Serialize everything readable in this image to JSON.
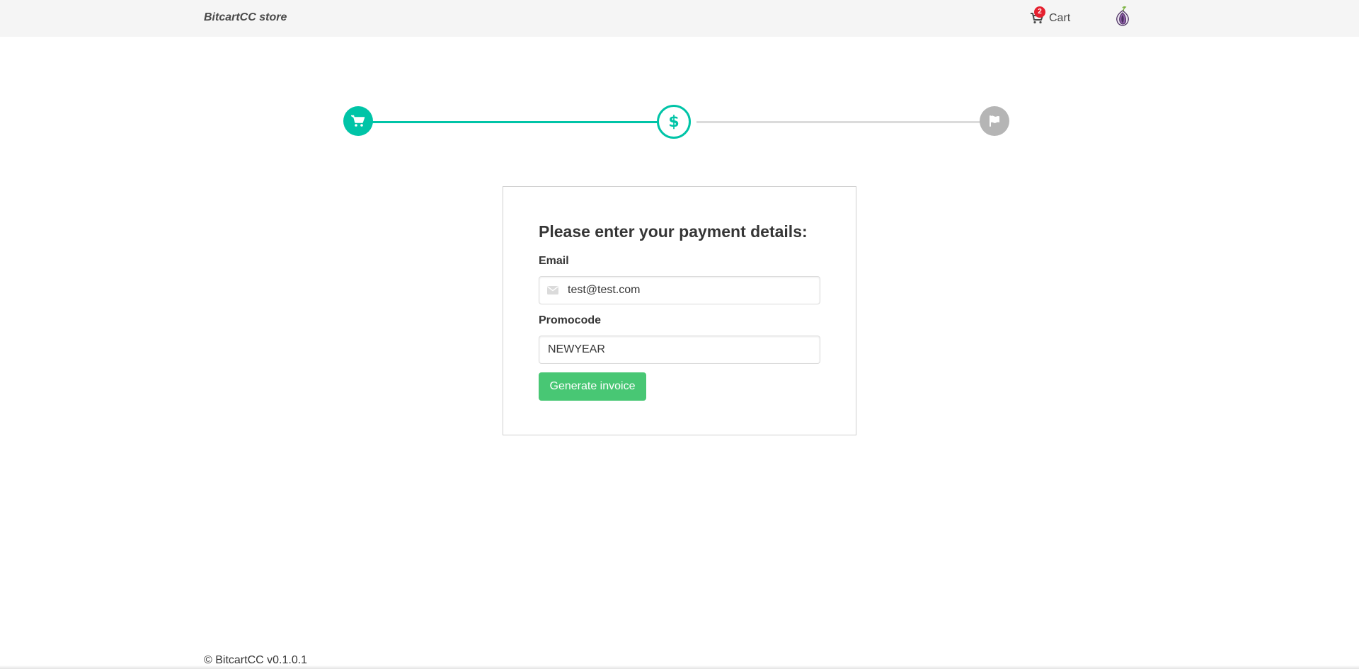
{
  "navbar": {
    "brand": "BitcartCC store",
    "cart_label": "Cart",
    "cart_count": "2",
    "icons": [
      "cart-icon",
      "tor-onion-icon"
    ]
  },
  "steps": {
    "current": 2,
    "items": [
      {
        "icon": "cart-icon",
        "status": "done"
      },
      {
        "icon": "dollar-icon",
        "label": "$",
        "status": "active"
      },
      {
        "icon": "flag-icon",
        "status": "pending"
      }
    ],
    "active_color": "#00c4a7",
    "pending_color": "#b5b5b5"
  },
  "form": {
    "title": "Please enter your payment details:",
    "email_label": "Email",
    "email_value": "test@test.com",
    "email_icon": "envelope-icon",
    "promo_label": "Promocode",
    "promo_value": "NEWYEAR",
    "submit_label": "Generate invoice",
    "submit_color": "#48c774"
  },
  "footer": {
    "text": "© BitcartCC v0.1.0.1"
  }
}
